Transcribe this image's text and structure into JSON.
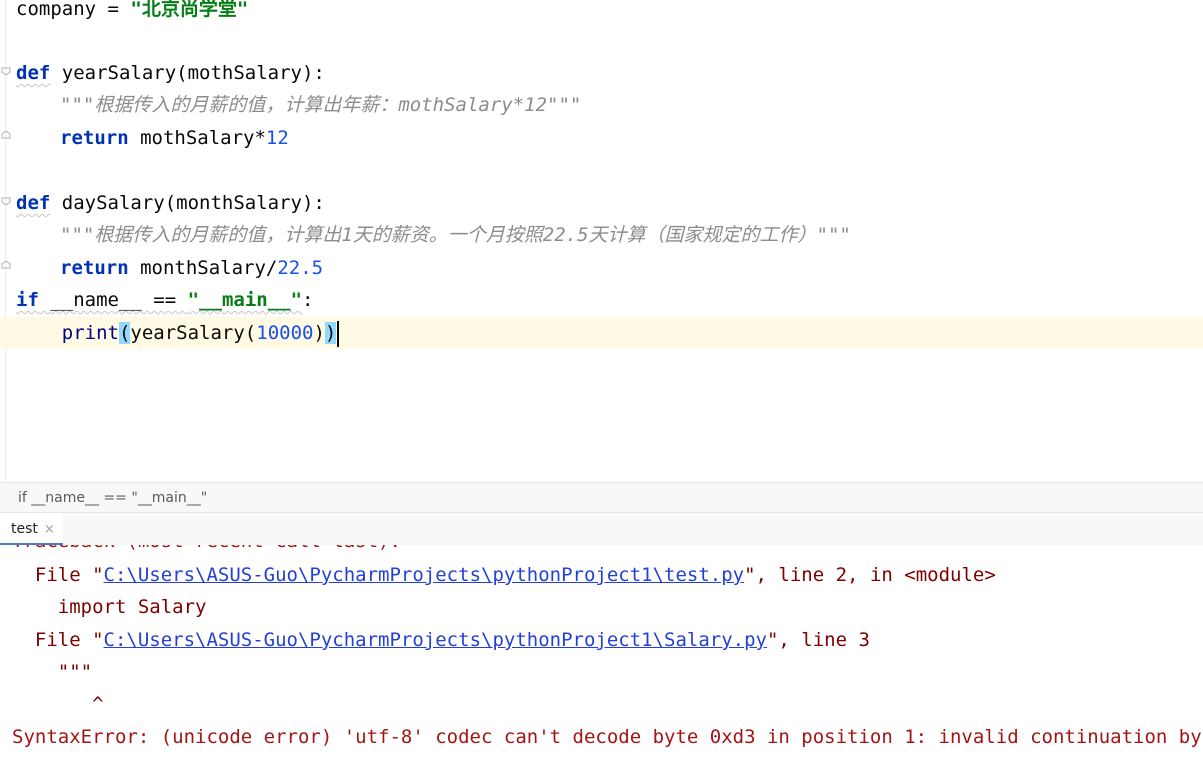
{
  "editor": {
    "lines": {
      "l1": {
        "var": "company",
        "eq": " = ",
        "str": "\"北京尚学堂\""
      },
      "l3": {
        "kw": "def",
        "sig": " yearSalary(mothSalary):"
      },
      "l4": {
        "doc": "\"\"\"根据传入的月薪的值，计算出年薪：mothSalary*12\"\"\""
      },
      "l5": {
        "kw": "return",
        "expr": " mothSalary*",
        "num": "12"
      },
      "l7": {
        "kw": "def",
        "sig": " daySalary(monthSalary):"
      },
      "l8": {
        "doc": "\"\"\"根据传入的月薪的值，计算出1天的薪资。一个月按照22.5天计算（国家规定的工作）\"\"\""
      },
      "l9": {
        "kw": "return",
        "expr": " monthSalary/",
        "num": "22.5"
      },
      "l10": {
        "kw": "if",
        "name": "__name__",
        "op": " == ",
        "str": "\"__main__\"",
        "colon": ":"
      },
      "l11": {
        "fn": "print",
        "open": "(",
        "mid": "yearSalary(",
        "num": "10000",
        "close1": ")",
        "close2": ")"
      }
    }
  },
  "breadcrumb": {
    "text": "if __name__ == \"__main__\""
  },
  "run_tab": {
    "label": "test",
    "close": "×"
  },
  "console": {
    "cut_line": "Traceback (most recent call last):",
    "f1_pre": "  File \"",
    "f1_link": "C:\\Users\\ASUS-Guo\\PycharmProjects\\pythonProject1\\test.py",
    "f1_post": "\", line 2, in <module>",
    "f1_code": "    import Salary",
    "f2_pre": "  File \"",
    "f2_link": "C:\\Users\\ASUS-Guo\\PycharmProjects\\pythonProject1\\Salary.py",
    "f2_post": "\", line 3",
    "f2_code": "    \"\"\"",
    "caret": "       ^",
    "error": "SyntaxError: (unicode error) 'utf-8' codec can't decode byte 0xd3 in position 1: invalid continuation byte"
  },
  "colors": {
    "keyword": "#0033b3",
    "string": "#067d17",
    "number": "#1750eb",
    "doc": "#8c8c8c",
    "error": "#a31515",
    "link": "#2440d6",
    "current_line": "#fffae3",
    "brace_match": "#93d9ff"
  }
}
